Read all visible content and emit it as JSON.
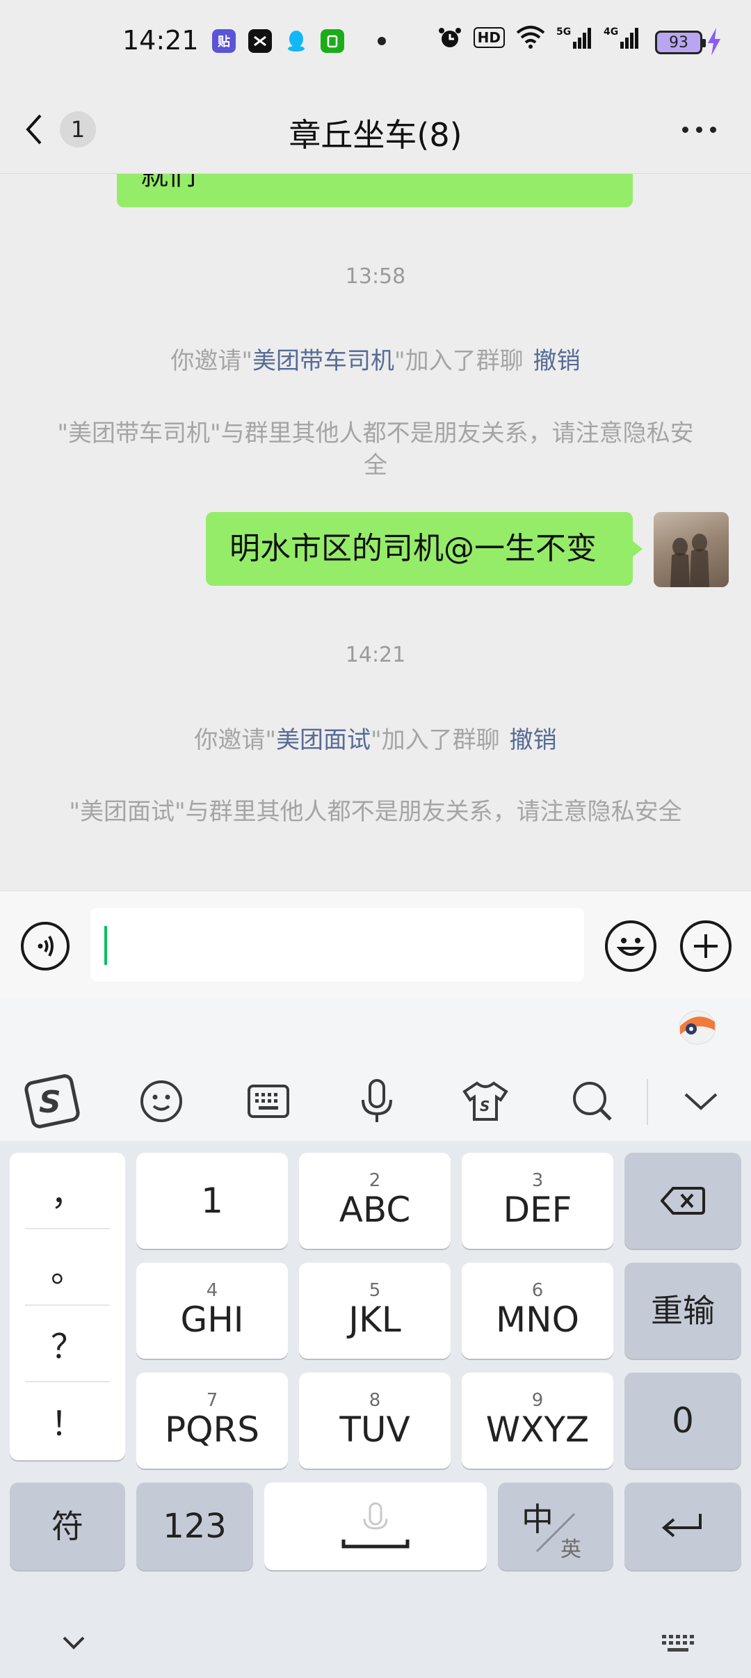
{
  "status_bar": {
    "time": "14:21",
    "notification_icons": [
      "tieba-icon",
      "capcut-icon",
      "qq-icon",
      "wechat-mini-icon"
    ],
    "system_icons": [
      "alarm-icon",
      "hd-icon",
      "wifi-icon",
      "5g-signal-icon",
      "4g-signal-icon"
    ],
    "battery_level": "93"
  },
  "header": {
    "unread_count": "1",
    "title": "章丘坐车(8)"
  },
  "messages": {
    "partial_bubble_text": "就们",
    "time_1": "13:58",
    "invite_1": {
      "prefix": "你邀请\"",
      "name": "美团带车司机",
      "suffix": "\"加入了群聊",
      "revoke": "撤销"
    },
    "warning_1": "\"美团带车司机\"与群里其他人都不是朋友关系，请注意隐私安全",
    "my_message": "明水市区的司机@一生不变",
    "time_2": "14:21",
    "invite_2": {
      "prefix": "你邀请\"",
      "name": "美团面试",
      "suffix": "\"加入了群聊",
      "revoke": "撤销"
    },
    "warning_2": "\"美团面试\"与群里其他人都不是朋友关系，请注意隐私安全"
  },
  "input": {
    "value": ""
  },
  "keyboard": {
    "toolbar": [
      "sogou-logo-icon",
      "emoji-icon",
      "keyboard-icon",
      "microphone-icon",
      "skin-icon",
      "search-icon",
      "collapse-icon"
    ],
    "punctuation": [
      "，",
      "。",
      "？",
      "！"
    ],
    "keys": {
      "k1": {
        "sub": "",
        "main": "1"
      },
      "k2": {
        "sub": "2",
        "main": "ABC"
      },
      "k3": {
        "sub": "3",
        "main": "DEF"
      },
      "k4": {
        "sub": "4",
        "main": "GHI"
      },
      "k5": {
        "sub": "5",
        "main": "JKL"
      },
      "k6": {
        "sub": "6",
        "main": "MNO"
      },
      "k7": {
        "sub": "7",
        "main": "PQRS"
      },
      "k8": {
        "sub": "8",
        "main": "TUV"
      },
      "k9": {
        "sub": "9",
        "main": "WXYZ"
      }
    },
    "retype": "重输",
    "zero": "0",
    "symbols": "符",
    "numbers": "123",
    "lang_main": "中",
    "lang_sub": "英"
  },
  "colors": {
    "bubble_green": "#95ec69",
    "link_blue": "#576b95",
    "caret_green": "#07c160"
  }
}
